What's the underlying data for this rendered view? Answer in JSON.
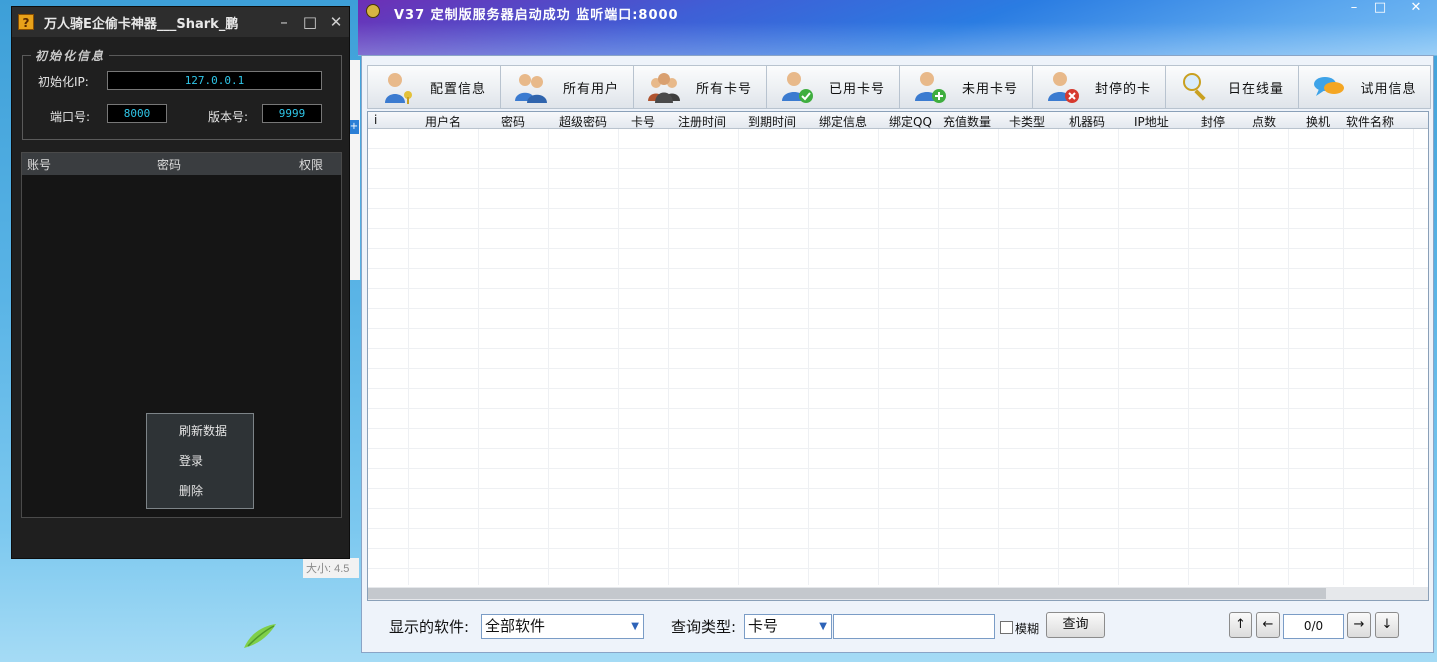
{
  "desktop": {
    "size_label": "大小: 4.5"
  },
  "left_window": {
    "title": "万人骑E企偷卡神器___Shark_鹏",
    "init_section": {
      "legend": "初始化信息",
      "ip_label": "初始化IP:",
      "ip_value": "127.0.0.1",
      "port_label": "端口号:",
      "port_value": "8000",
      "version_label": "版本号:",
      "version_value": "9999"
    },
    "grid_columns": [
      "账号",
      "密码",
      "权限"
    ],
    "context_menu": [
      "刷新数据",
      "登录",
      "删除"
    ]
  },
  "right_window": {
    "title": "V37 定制版服务器启动成功   监听端口:8000",
    "toolbar": [
      {
        "label": "配置信息",
        "icon": "user-key-icon"
      },
      {
        "label": "所有用户",
        "icon": "users-icon"
      },
      {
        "label": "所有卡号",
        "icon": "group-icon"
      },
      {
        "label": "已用卡号",
        "icon": "user-check-icon"
      },
      {
        "label": "未用卡号",
        "icon": "user-add-icon"
      },
      {
        "label": "封停的卡",
        "icon": "user-block-icon"
      },
      {
        "label": "日在线量",
        "icon": "magnifier-icon"
      },
      {
        "label": "试用信息",
        "icon": "chat-bubble-icon"
      }
    ],
    "table_columns": [
      "i",
      "用户名",
      "密码",
      "超级密码",
      "卡号",
      "注册时间",
      "到期时间",
      "绑定信息",
      "绑定QQ",
      "充值数量",
      "卡类型",
      "机器码",
      "IP地址",
      "封停",
      "点数",
      "换机",
      "软件名称"
    ],
    "bottom": {
      "software_label": "显示的软件:",
      "software_value": "全部软件",
      "query_type_label": "查询类型:",
      "query_type_value": "卡号",
      "query_input": "",
      "fuzzy_label": "模糊",
      "query_button": "查询",
      "nav_up": "↑",
      "nav_left": "←",
      "page_value": "0/0",
      "nav_right": "→",
      "nav_down": "↓"
    }
  }
}
